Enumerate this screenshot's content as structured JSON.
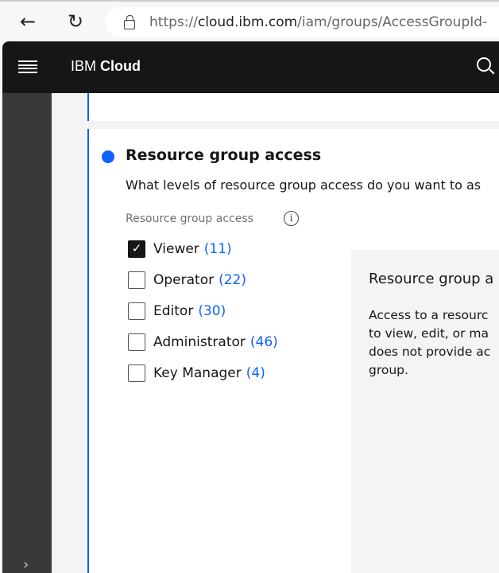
{
  "browser": {
    "url_scheme": "https://",
    "url_host": "cloud.ibm.com",
    "url_path": "/iam/groups/AccessGroupId-"
  },
  "header": {
    "brand_prefix": "IBM",
    "brand_name": "Cloud"
  },
  "section": {
    "title": "Resource group access",
    "question": "What levels of resource group access do you want to as",
    "field_label": "Resource group access",
    "options": [
      {
        "label": "Viewer",
        "count": "(11)",
        "checked": true
      },
      {
        "label": "Operator",
        "count": "(22)",
        "checked": false
      },
      {
        "label": "Editor",
        "count": "(30)",
        "checked": false
      },
      {
        "label": "Administrator",
        "count": "(46)",
        "checked": false
      },
      {
        "label": "Key Manager",
        "count": "(4)",
        "checked": false
      }
    ],
    "panel": {
      "title": "Resource group a",
      "lines": [
        "Access to a resourc",
        "to view, edit, or ma",
        "does not provide ac",
        "group."
      ]
    }
  },
  "colors": {
    "accent": "#0f62fe",
    "header": "#161616",
    "sidebar": "#393939"
  }
}
